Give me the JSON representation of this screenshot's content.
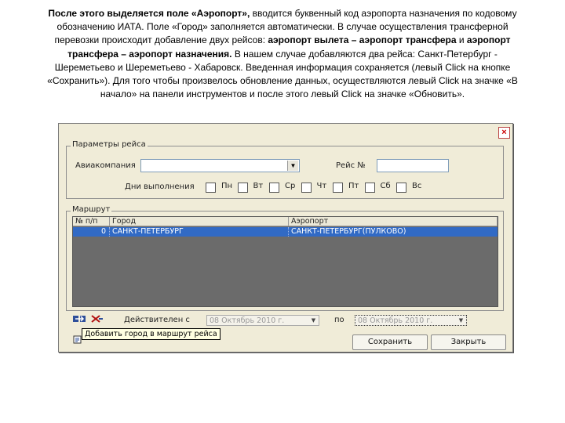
{
  "instructions": {
    "l1_b": "После этого выделяется поле «Аэропорт»,",
    "l1_t": " вводится буквенный код  аэропорта назначения по кодовому",
    "l2": "обозначению ИАТА. Поле «Город» заполняется автоматически. В случае осуществления трансферной",
    "l3_t": "перевозки происходит добавление двух рейсов: ",
    "l3_b": "аэропорт вылета – аэропорт трансфера",
    "l3_t2": " и ",
    "l3_b2": "аэропорт",
    "l4_b": "трансфера – аэропорт назначения.",
    "l4_t": " В нашем случае добавляются два рейса: Санкт-Петербург -",
    "l5": "Шереметьево и Шереметьево - Хабаровск.  Введенная информация сохраняется (левый Click на кнопке",
    "l6": "«Сохранить»). Для того чтобы произвелось обновление данных, осуществляются левый Click на значке «В",
    "l7": "начало» на панели инструментов и после этого левый Click на значке «Обновить»."
  },
  "window": {
    "close_glyph": "×",
    "params_group": {
      "legend": "Параметры рейса",
      "airline_label": "Авиакомпания",
      "airline_value": "",
      "flight_label": "Рейс №",
      "flight_value": "",
      "days_label": "Дни выполнения",
      "days": [
        "Пн",
        "Вт",
        "Ср",
        "Чт",
        "Пт",
        "Сб",
        "Вс"
      ]
    },
    "route_group": {
      "legend": "Маршрут",
      "columns": [
        "№ п/п",
        "Город",
        "Аэропорт"
      ],
      "rows": [
        {
          "num": "0",
          "city": "САНКТ-ПЕТЕРБУРГ",
          "airport": "САНКТ-ПЕТЕРБУРГ(ПУЛКОВО)"
        }
      ]
    },
    "validity": {
      "from_label": "Действителен  с",
      "from_value": "08  Октябрь  2010 г.",
      "to_label": "по",
      "to_value": "08  Октябрь  2010 г."
    },
    "tooltip": "Добавить город в маршрут рейса",
    "save_button": "Сохранить",
    "close_button": "Закрыть",
    "colors": {
      "selection": "#316ac5",
      "window_bg": "#f0ecd8",
      "grid_bg": "#6b6b6b"
    }
  }
}
